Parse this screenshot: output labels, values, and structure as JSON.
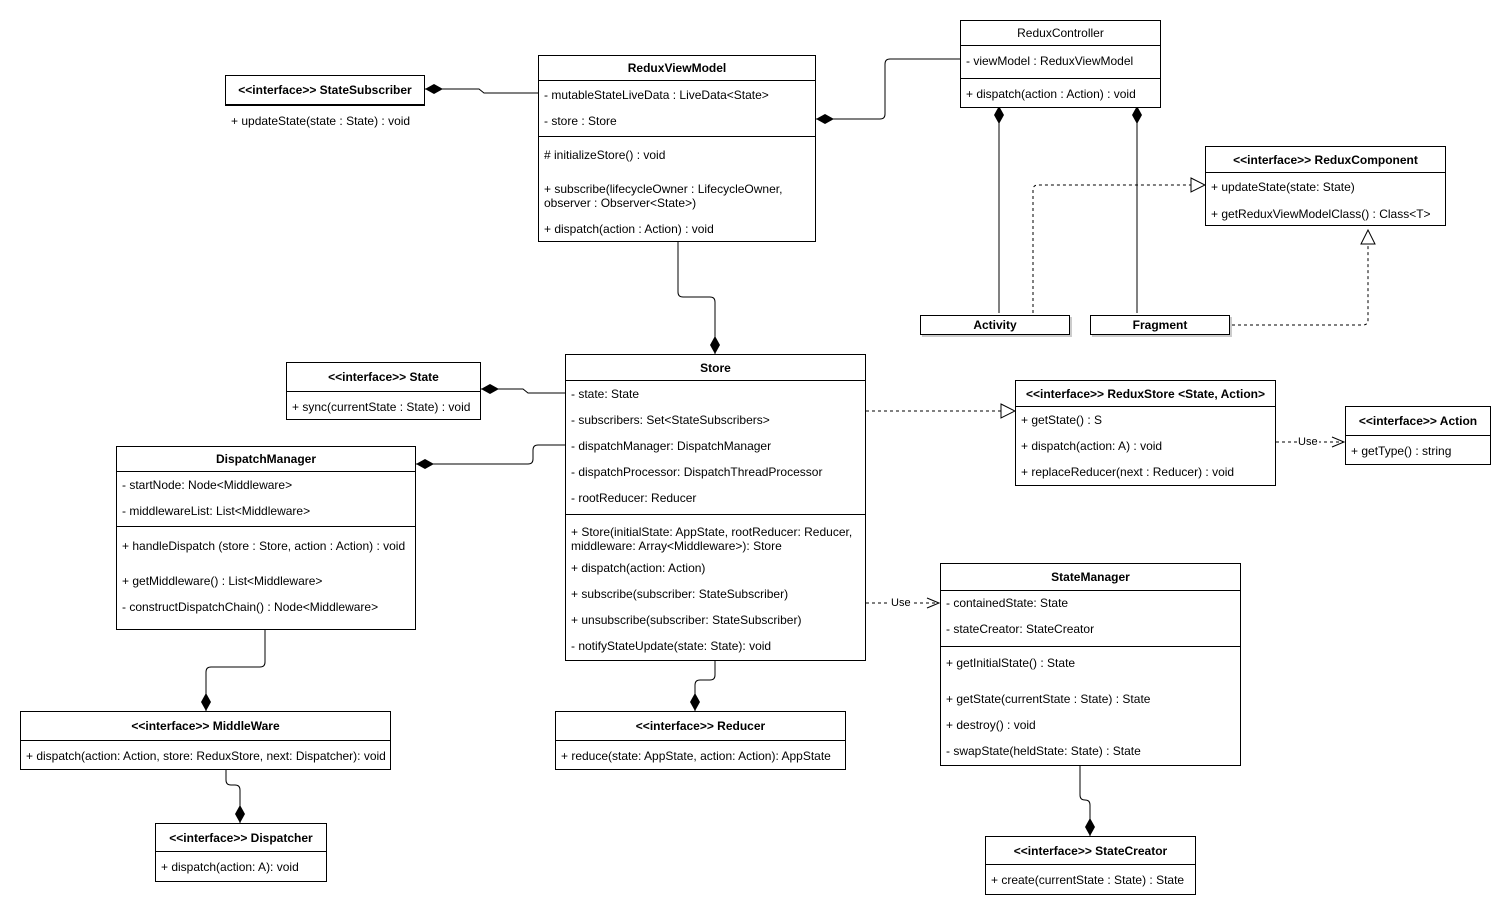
{
  "classes": [
    {
      "id": "state-subscriber",
      "title": "<<interface>> StateSubscriber",
      "sections": [
        [
          "+ updateState(state : State) : void"
        ]
      ]
    },
    {
      "id": "redux-view-model",
      "title": "ReduxViewModel",
      "sections": [
        [
          "- mutableStateLiveData : LiveData<State>",
          "- store : Store"
        ],
        [
          "# initializeStore() : void",
          "+ subscribe(lifecycleOwner : LifecycleOwner,\nobserver : Observer<State>)",
          "+ dispatch(action : Action) : void"
        ]
      ]
    },
    {
      "id": "redux-controller",
      "title": "ReduxController",
      "plain": true,
      "sections": [
        [
          "- viewModel : ReduxViewModel"
        ],
        [
          "+ dispatch(action : Action) : void"
        ]
      ]
    },
    {
      "id": "redux-component",
      "title": "<<interface>> ReduxComponent",
      "sections": [
        [
          "+ updateState(state: State)",
          "+ getReduxViewModelClass() : Class<T>"
        ]
      ]
    },
    {
      "id": "state",
      "title": "<<interface>> State",
      "sections": [
        [
          "+ sync(currentState : State) : void"
        ]
      ]
    },
    {
      "id": "store",
      "title": "Store",
      "sections": [
        [
          "- state: State",
          "- subscribers: Set<StateSubscribers>",
          "- dispatchManager: DispatchManager",
          "- dispatchProcessor: DispatchThreadProcessor",
          "- rootReducer: Reducer"
        ],
        [
          "+ Store(initialState: AppState, rootReducer: Reducer,\nmiddleware: Array<Middleware>): Store",
          "+ dispatch(action: Action)",
          "+ subscribe(subscriber: StateSubscriber)",
          "+ unsubscribe(subscriber: StateSubscriber)",
          "- notifyStateUpdate(state: State): void"
        ]
      ]
    },
    {
      "id": "redux-store",
      "title": "<<interface>> ReduxStore <State, Action>",
      "sections": [
        [
          "+ getState() : S",
          "+ dispatch(action: A) : void",
          "+ replaceReducer(next : Reducer) : void"
        ]
      ]
    },
    {
      "id": "action",
      "title": "<<interface>> Action",
      "sections": [
        [
          "+ getType() : string"
        ]
      ]
    },
    {
      "id": "dispatch-manager",
      "title": "DispatchManager",
      "sections": [
        [
          "- startNode: Node<Middleware>",
          "- middlewareList: List<Middleware>"
        ],
        [
          "+ handleDispatch (store : Store,  action : Action) : void",
          "+ getMiddleware() : List<Middleware>",
          "- constructDispatchChain() : Node<Middleware>"
        ]
      ]
    },
    {
      "id": "middleware",
      "title": "<<interface>> MiddleWare",
      "sections": [
        [
          "+ dispatch(action: Action, store: ReduxStore, next: Dispatcher): void"
        ]
      ]
    },
    {
      "id": "reducer",
      "title": "<<interface>> Reducer",
      "sections": [
        [
          "+ reduce(state: AppState, action: Action): AppState"
        ]
      ]
    },
    {
      "id": "dispatcher",
      "title": "<<interface>> Dispatcher",
      "sections": [
        [
          "+ dispatch(action: A): void"
        ]
      ]
    },
    {
      "id": "state-manager",
      "title": "StateManager",
      "sections": [
        [
          "- containedState: State",
          "- stateCreator: StateCreator"
        ],
        [
          "+ getInitialState() : State",
          "+ getState(currentState : State) : State",
          "+ destroy() : void",
          "- swapState(heldState: State) : State"
        ]
      ]
    },
    {
      "id": "state-creator",
      "title": "<<interface>> StateCreator",
      "sections": [
        [
          "+ create(currentState : State) : State"
        ]
      ]
    }
  ],
  "simple_classes": [
    {
      "id": "activity",
      "title": "Activity"
    },
    {
      "id": "fragment",
      "title": "Fragment"
    }
  ],
  "links": {
    "use_label": "Use"
  }
}
